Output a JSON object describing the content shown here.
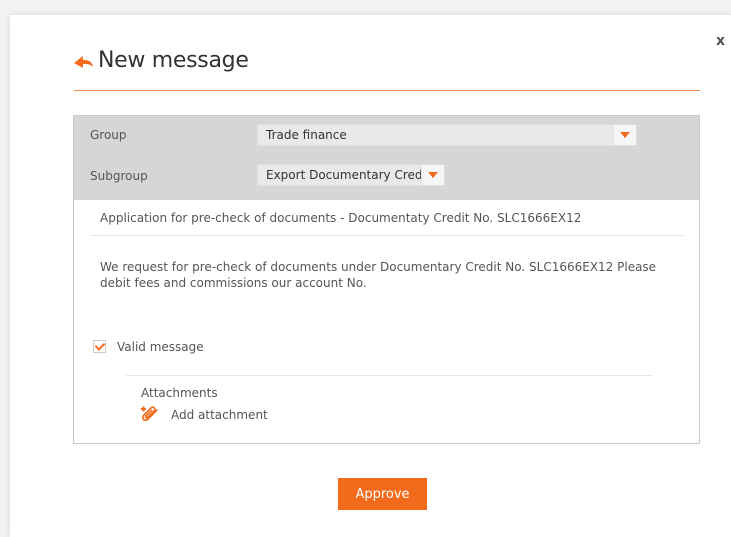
{
  "dialog": {
    "title": "New message",
    "close_label": "x"
  },
  "form": {
    "group_label": "Group",
    "group_value": "Trade finance",
    "subgroup_label": "Subgroup",
    "subgroup_value": "Export Documentary Credit",
    "subject": "Application for pre-check of documents - Documentaty Credit No. SLC1666EX12",
    "body": "We request for pre-check of documents under Documentary Credit No. SLC1666EX12 Please debit fees and commissions our account No.",
    "valid_message_label": "Valid message",
    "valid_message_checked": true,
    "attachments_label": "Attachments",
    "add_attachment_label": "Add attachment"
  },
  "actions": {
    "approve_label": "Approve"
  },
  "colors": {
    "accent": "#f26a1b",
    "band": "#d6d6d6"
  },
  "icons": {
    "back": "back-arrow-icon",
    "add_attachment": "paperclip-plus-icon",
    "dropdown": "chevron-down-icon",
    "close": "close-icon"
  }
}
